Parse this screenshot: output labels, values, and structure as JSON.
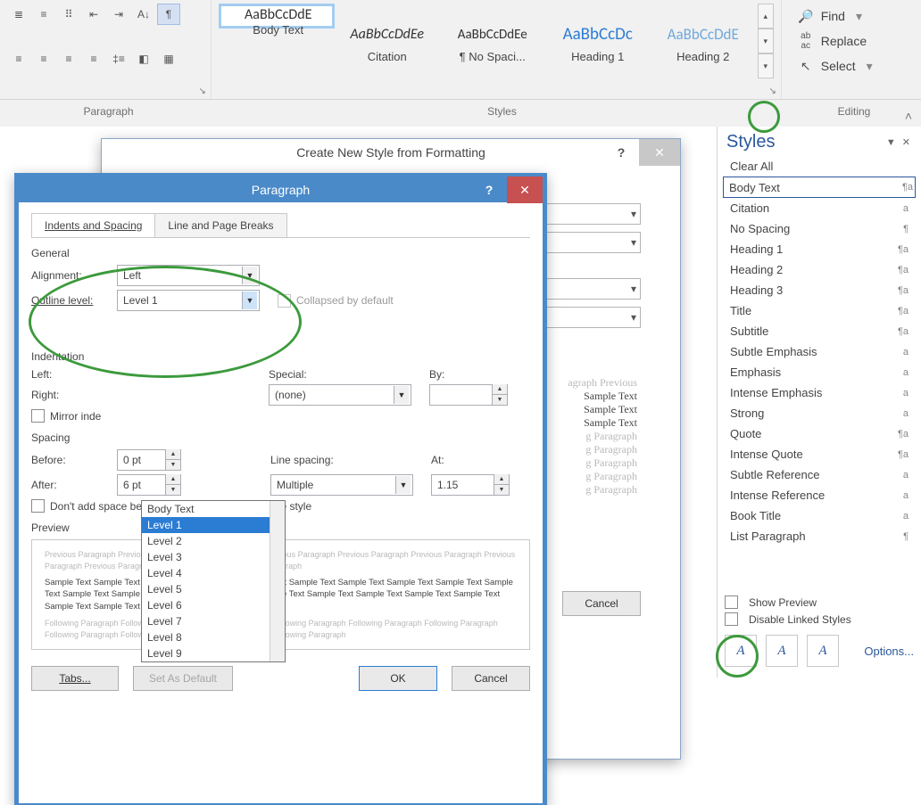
{
  "ribbon": {
    "paragraph_label": "Paragraph",
    "styles_label": "Styles",
    "editing_label": "Editing",
    "find": "Find",
    "replace": "Replace",
    "select": "Select",
    "gallery": [
      {
        "sample": "AaBbCcDdE",
        "name": "Body Text",
        "selected": true,
        "css": "font-family:Calibri"
      },
      {
        "sample": "AaBbCcDdEe",
        "name": "Citation",
        "css": "font-style:italic;font-family:Calibri"
      },
      {
        "sample": "AaBbCcDdEe",
        "name": "¶ No Spaci...",
        "css": "font-family:Calibri;font-size:15px"
      },
      {
        "sample": "AaBbCcDc",
        "name": "Heading 1",
        "css": "color:#2b7cd3;font-size:19px;font-family:Calibri"
      },
      {
        "sample": "AaBbCcDdE",
        "name": "Heading 2",
        "css": "color:#6fa8dc;font-size:17px;font-family:Calibri"
      }
    ]
  },
  "styles_pane": {
    "title": "Styles",
    "items": [
      {
        "label": "Clear All",
        "g": ""
      },
      {
        "label": "Body Text",
        "g": "¶a",
        "sel": true
      },
      {
        "label": "Citation",
        "g": "a"
      },
      {
        "label": "No Spacing",
        "g": "¶"
      },
      {
        "label": "Heading 1",
        "g": "¶a"
      },
      {
        "label": "Heading 2",
        "g": "¶a"
      },
      {
        "label": "Heading 3",
        "g": "¶a"
      },
      {
        "label": "Title",
        "g": "¶a"
      },
      {
        "label": "Subtitle",
        "g": "¶a"
      },
      {
        "label": "Subtle Emphasis",
        "g": "a"
      },
      {
        "label": "Emphasis",
        "g": "a"
      },
      {
        "label": "Intense Emphasis",
        "g": "a"
      },
      {
        "label": "Strong",
        "g": "a"
      },
      {
        "label": "Quote",
        "g": "¶a"
      },
      {
        "label": "Intense Quote",
        "g": "¶a"
      },
      {
        "label": "Subtle Reference",
        "g": "a"
      },
      {
        "label": "Intense Reference",
        "g": "a"
      },
      {
        "label": "Book Title",
        "g": "a"
      },
      {
        "label": "List Paragraph",
        "g": "¶"
      }
    ],
    "show_preview": "Show Preview",
    "disable_linked": "Disable Linked Styles",
    "options": "Options..."
  },
  "dlg_new": {
    "title": "Create New Style from Formatting",
    "prev_line": "agraph Previous",
    "sample": "Sample Text",
    "follow": "g Paragraph",
    "cancel": "Cancel"
  },
  "dlg_para": {
    "title": "Paragraph",
    "tabs": {
      "a": "Indents and Spacing",
      "b": "Line and Page Breaks"
    },
    "general": "General",
    "alignment": "Alignment:",
    "alignment_val": "Left",
    "outline": "Outline level:",
    "outline_val": "Level 1",
    "collapsed": "Collapsed by default",
    "indentation": "Indentation",
    "left": "Left:",
    "right": "Right:",
    "special": "Special:",
    "special_val": "(none)",
    "by": "By:",
    "mirror": "Mirror inde",
    "spacing": "Spacing",
    "before": "Before:",
    "before_val": "0 pt",
    "after": "After:",
    "after_val": "6 pt",
    "line_spacing": "Line spacing:",
    "line_val": "Multiple",
    "at": "At:",
    "at_val": "1.15",
    "noadd": "Don't add space between paragraphs of the same style",
    "preview": "Preview",
    "prev_gray": "Previous Paragraph Previous Paragraph Previous Paragraph Previous Paragraph Previous Paragraph Previous Paragraph Previous Paragraph Previous Paragraph Previous Paragraph Previous Paragraph",
    "prev_dark": "Sample Text Sample Text Sample Text Sample Text Sample Text Sample Text Sample Text Sample Text Sample Text Sample Text Sample Text Sample Text Sample Text Sample Text Sample Text Sample Text Sample Text Sample Text Sample Text Sample Text Sample Text",
    "prev_follow": "Following Paragraph Following Paragraph Following Paragraph Following Paragraph Following Paragraph Following Paragraph Following Paragraph Following Paragraph Following Paragraph Following Paragraph",
    "tabs_btn": "Tabs...",
    "default_btn": "Set As Default",
    "ok": "OK",
    "cancel": "Cancel",
    "dropdown": [
      "Body Text",
      "Level 1",
      "Level 2",
      "Level 3",
      "Level 4",
      "Level 5",
      "Level 6",
      "Level 7",
      "Level 8",
      "Level 9"
    ]
  }
}
